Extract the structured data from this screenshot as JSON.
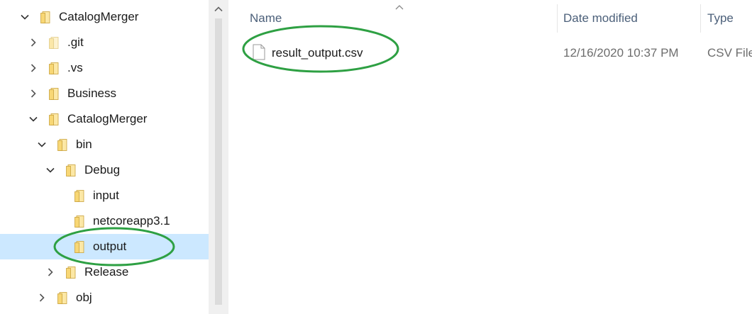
{
  "nav": {
    "items": [
      {
        "label": "CatalogMerger",
        "icon": "folder-icon",
        "expanded": true
      },
      {
        "label": ".git",
        "icon": "folder-icon",
        "expanded": false
      },
      {
        "label": ".vs",
        "icon": "folder-icon",
        "expanded": false
      },
      {
        "label": "Business",
        "icon": "folder-icon",
        "expanded": false
      },
      {
        "label": "CatalogMerger",
        "icon": "folder-icon",
        "expanded": true
      },
      {
        "label": "bin",
        "icon": "folder-icon",
        "expanded": true
      },
      {
        "label": "Debug",
        "icon": "folder-icon",
        "expanded": true
      },
      {
        "label": "input",
        "icon": "folder-icon"
      },
      {
        "label": "netcoreapp3.1",
        "icon": "folder-icon"
      },
      {
        "label": "output",
        "icon": "folder-icon",
        "selected": true
      },
      {
        "label": "Release",
        "icon": "folder-icon",
        "expanded": false
      },
      {
        "label": "obj",
        "icon": "folder-icon",
        "expanded": false
      }
    ]
  },
  "content": {
    "columns": {
      "name": "Name",
      "date": "Date modified",
      "type": "Type"
    },
    "files": [
      {
        "name": "result_output.csv",
        "date_modified": "12/16/2020 10:37 PM",
        "type": "CSV File",
        "icon": "file-icon"
      }
    ]
  },
  "colors": {
    "selection": "#cce8ff",
    "folder": "#f8d775",
    "annotation": "#2ea043",
    "header_text": "#4c607a",
    "meta_text": "#6d6d6d"
  }
}
